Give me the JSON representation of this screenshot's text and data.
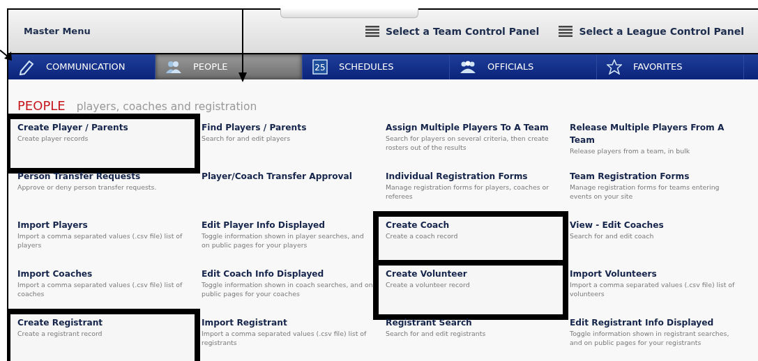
{
  "header": {
    "title": "Master Menu",
    "links": [
      "Select a Team Control Panel",
      "Select a League Control Panel"
    ]
  },
  "tabs": [
    {
      "label": "COMMUNICATION",
      "selected": false
    },
    {
      "label": "PEOPLE",
      "selected": true
    },
    {
      "label": "SCHEDULES",
      "day": "25",
      "selected": false
    },
    {
      "label": "OFFICIALS",
      "selected": false
    },
    {
      "label": "FAVORITES",
      "selected": false
    }
  ],
  "section": {
    "title": "PEOPLE",
    "subtitle": "players, coaches and registration"
  },
  "items": [
    {
      "title": "Create Player / Parents",
      "description": "Create player records",
      "highlighted": true
    },
    {
      "title": "Find Players / Parents",
      "description": "Search for and edit players",
      "highlighted": false
    },
    {
      "title": "Assign Multiple Players To A Team",
      "description": "Search for players on several criteria, then create rosters out of the results",
      "highlighted": false
    },
    {
      "title": "Release Multiple Players From A Team",
      "description": "Release players from a team, in bulk",
      "highlighted": false
    },
    {
      "title": "Person Transfer Requests",
      "description": "Approve or deny person transfer requests.",
      "highlighted": false
    },
    {
      "title": "Player/Coach Transfer Approval",
      "highlighted": false
    },
    {
      "title": "Individual Registration Forms",
      "description": "Manage registration forms for players, coaches or referees",
      "highlighted": false
    },
    {
      "title": "Team Registration Forms",
      "description": "Manage registration forms for teams entering events on your site",
      "highlighted": false
    },
    {
      "title": "Import Players",
      "description": "Import a comma separated values (.csv file) list of players",
      "highlighted": false
    },
    {
      "title": "Edit Player Info Displayed",
      "description": "Toggle information shown in player searches, and on public pages for your players",
      "highlighted": false
    },
    {
      "title": "Create Coach",
      "description": "Create a coach record",
      "highlighted": true
    },
    {
      "title": "View - Edit Coaches",
      "description": "Search for and edit coach",
      "highlighted": false
    },
    {
      "title": "Import Coaches",
      "description": "Import a comma separated values (.csv file) list of coaches",
      "highlighted": false
    },
    {
      "title": "Edit Coach Info Displayed",
      "description": "Toggle information shown in coach searches, and on public pages for your coaches",
      "highlighted": false
    },
    {
      "title": "Create Volunteer",
      "description": "Create a volunteer record",
      "highlighted": true
    },
    {
      "title": "Import Volunteers",
      "description": "Import a comma separated values (.csv file) list of volunteers",
      "highlighted": false
    },
    {
      "title": "Create Registrant",
      "description": "Create a registrant record",
      "highlighted": true
    },
    {
      "title": "Import Registrant",
      "description": "Import a comma separated values (.csv file) list of registrants",
      "highlighted": false
    },
    {
      "title": "Registrant Search",
      "description": "Search for and edit registrants",
      "highlighted": false
    },
    {
      "title": "Edit Registrant Info Displayed",
      "description": "Toggle information shown in registrant searches, and on public pages for your registrants",
      "highlighted": false
    }
  ]
}
